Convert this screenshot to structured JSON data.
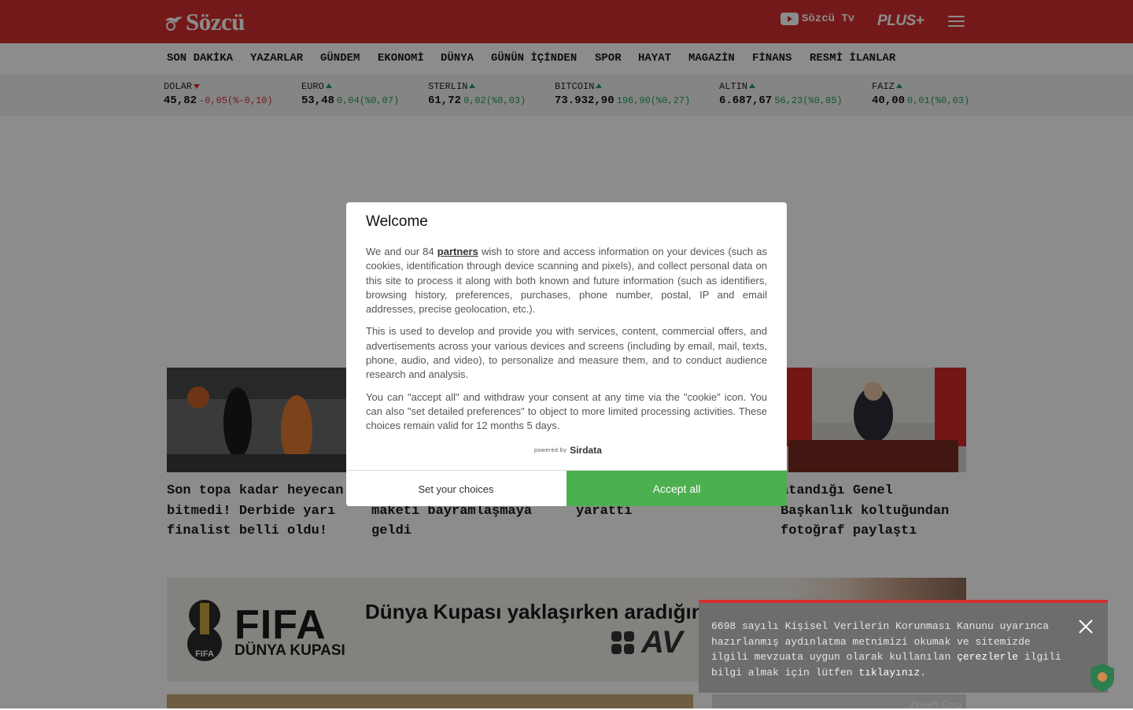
{
  "header": {
    "logo_text": "Sözcü",
    "sozcu_tv": "Sözcü Tv",
    "plus": "PLUS+"
  },
  "nav": {
    "items": [
      "SON DAKİKA",
      "YAZARLAR",
      "GÜNDEM",
      "EKONOMİ",
      "DÜNYA",
      "GÜNÜN İÇİNDEN",
      "SPOR",
      "HAYAT",
      "MAGAZİN",
      "FİNANS",
      "RESMİ İLANLAR"
    ]
  },
  "ticker": [
    {
      "label": "DOLAR",
      "value": "45,82",
      "change": "-0,05(%-0,10)",
      "direction": "down"
    },
    {
      "label": "EURO",
      "value": "53,48",
      "change": "0,04(%0,07)",
      "direction": "up"
    },
    {
      "label": "STERLIN",
      "value": "61,72",
      "change": "0,02(%0,03)",
      "direction": "up"
    },
    {
      "label": "BITCOIN",
      "value": "73.932,90",
      "change": "196,90(%0,27)",
      "direction": "up"
    },
    {
      "label": "ALTIN",
      "value": "6.687,67",
      "change": "56,23(%0,85)",
      "direction": "up"
    },
    {
      "label": "FAIZ",
      "value": "40,00",
      "change": "0,01(%0,03)",
      "direction": "up"
    }
  ],
  "news": [
    {
      "title": "Son topa kadar heyecan bitmedi! Derbide yarı finalist belli oldu!"
    },
    {
      "title": "Başkanının yerine maketi bayramlaşmaya geldi"
    },
    {
      "title": "görüntüler tartışma yarattı"
    },
    {
      "title": "atandığı Genel Başkanlık koltuğundan fotoğraf paylaştı"
    }
  ],
  "promo": {
    "fifa_text": "FIFA",
    "fifa_sub": "DÜNYA KUPASI",
    "title": "Dünya Kupası yaklaşırken aradığın",
    "brand": "AV"
  },
  "bottom_ad_label": "Zweeft Corp",
  "consent": {
    "title": "Welcome",
    "p1_before": "We and our 84 ",
    "p1_link": "partners",
    "p1_after": " wish to store and access information on your devices (such as cookies, identification through device scanning and pixels), and collect personal data on this site to process it along with both known and future information (such as identifiers, browsing history, preferences, purchases, phone number, postal, IP and email addresses, precise geolocation, etc.).",
    "p2": "This is used to develop and provide you with services, content, commercial offers, and advertisements across your various devices and screens (including by email, mail, texts, phone, audio, and video), to personalize and measure them, and to conduct audience research and analysis.",
    "p3": "You can \"accept all\" and withdraw your consent at any time via the \"cookie\" icon. You can also \"set detailed preferences\" to object to more limited processing activities. These choices remain valid for 12 months 5 days.",
    "powered_by": "powered by",
    "powered_brand": "Sirdata",
    "set_choices": "Set your choices",
    "accept_all": "Accept all"
  },
  "kvkk": {
    "text_before": "6698 sayılı Kişisel Verilerin Korunması Kanunu uyarınca hazırlanmış aydınlatma metnimizi okumak ve sitemizde ilgili mevzuata uygun olarak kullanılan ",
    "link1": "çerezlerle",
    "text_middle": " ilgili bilgi almak için lütfen ",
    "link2": "tıklayınız",
    "text_after": "."
  },
  "colors": {
    "brand_red": "#d32f2f",
    "accept_green": "#4caf50",
    "up_green": "#1e9e57"
  }
}
